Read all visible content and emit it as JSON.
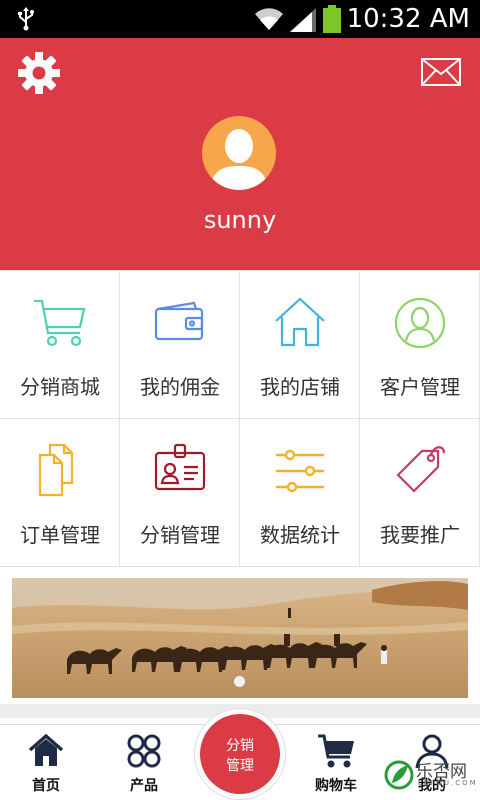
{
  "status_bar": {
    "time": "10:32 AM"
  },
  "header": {
    "username": "sunny",
    "accent_color": "#da3b45"
  },
  "menu": [
    {
      "label": "分销商城",
      "icon": "cart-icon"
    },
    {
      "label": "我的佣金",
      "icon": "wallet-icon"
    },
    {
      "label": "我的店铺",
      "icon": "home-icon"
    },
    {
      "label": "客户管理",
      "icon": "user-circle-icon"
    },
    {
      "label": "订单管理",
      "icon": "documents-icon"
    },
    {
      "label": "分销管理",
      "icon": "id-badge-icon"
    },
    {
      "label": "数据统计",
      "icon": "sliders-icon"
    },
    {
      "label": "我要推广",
      "icon": "tag-icon"
    }
  ],
  "tabbar": {
    "home": "首页",
    "products": "产品",
    "center_line1": "分销",
    "center_line2": "管理",
    "cart": "购物车",
    "mine": "我的"
  },
  "watermark": {
    "text": "乐否网",
    "sub": "LEFOU.COM"
  }
}
